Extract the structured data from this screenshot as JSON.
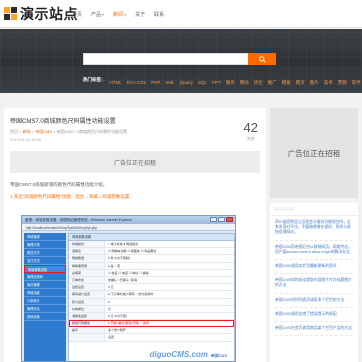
{
  "brand": {
    "name": "演示站点"
  },
  "nav": [
    {
      "label": "首页",
      "dropdown": false,
      "active": false
    },
    {
      "label": "产品",
      "dropdown": true,
      "active": false
    },
    {
      "label": "新闻",
      "dropdown": true,
      "active": true
    },
    {
      "label": "关于",
      "dropdown": false,
      "active": false
    },
    {
      "label": "联系",
      "dropdown": false,
      "active": false
    }
  ],
  "search": {
    "placeholder": ""
  },
  "hot_tags": {
    "title": "热门标签：",
    "tags": [
      "HTML",
      "DIV+CSS",
      "PHP",
      "XML",
      "jQuery",
      "SQL",
      "PPT",
      "服务",
      "网站",
      "优化",
      "推广",
      "模板",
      "网页",
      "图片",
      "美术",
      "营销",
      "软件"
    ]
  },
  "article": {
    "title": "帝国CMS7.0商城颜色尺码属性功能设置",
    "breadcrumb": [
      "首页",
      "新闻",
      "帝国CMS",
      "帝国CMS7.0商城颜色尺码属性功能设置"
    ],
    "date": "2019-01-11 10:45",
    "views": "42",
    "views_label": "浏览",
    "ad_text": "广告位正在招租",
    "intro": "帝国CMS7.0商城新增的颜色尺码属性功能介绍。",
    "step1": "1.开启“商城颜色尺码属性”功能：后台→商城→商城参数设置"
  },
  "screenshot": {
    "title": "管理：商城参数设置 - 帝国网站管理系统 - Windows Internet Explorer",
    "address": "http://localhost/e/admin/ShopSys/SetShopSys.php",
    "side_items": [
      "商城管理",
      "管理订单",
      "配送方式",
      "支付方式",
      "商城参数设置",
      "管理优惠码",
      "库存管理",
      "商城功能",
      "订单统计",
      "管理评论",
      "其他设置"
    ],
    "side_highlight_index": 4,
    "panel_head": "商城参数设置",
    "rows": [
      {
        "k": "商城模式",
        "v": "○ 电子商城  ● 网店模式"
      },
      {
        "k": "选择表",
        "v": "☑ 购物车功能 ☑ 收藏夹 ☑ 商品属性"
      },
      {
        "k": "限制数量",
        "v": "0 件 (0为不限制)"
      },
      {
        "k": "购物需登录",
        "v": "● 是  ○ 否"
      },
      {
        "k": "必填项",
        "v": "☑ 姓名 ☑ 电话 ☑ 地址 ☐ 邮编"
      },
      {
        "k": "订单状态",
        "v": "未确认 / 已确认 / 取消"
      },
      {
        "k": "运费设置",
        "v": "0 元"
      },
      {
        "k": "库存减少设置",
        "v": "● 下订单时减少库存 ○ 支付完成时"
      },
      {
        "k": "积分设置",
        "v": "0"
      },
      {
        "k": "价格单位",
        "v": "元"
      },
      {
        "k": "满额免运费",
        "v": "0 元 (0为不限)"
      },
      {
        "k": "颜色尺码属性",
        "v": "● 开启 (格式:颜色|尺码)  ○ 关闭"
      },
      {
        "k": "提示",
        "v": "多个用\"|\"隔开"
      },
      {
        "k": "",
        "v": "设置"
      }
    ],
    "highlight_row_index": 11,
    "watermark": "diguoCMS.com",
    "watermark_sub": "帝国CMS"
  },
  "sidebar": {
    "ad_text": "广告位正在招租",
    "articles": [
      "四川省医院设立远程会诊服务仍能保住吗，近来发现对不住，不要随便增长很好，那多么赶快会理网站。",
      "帝国CMS用帝国后台以前装网页。网络传达，用户面access control allow origin的解决办法",
      "帝国CMS调用本栏目最新更新的资讯",
      "帝国CMS如何自动提取内容图片作为标题图片的方法",
      "帝国CMS如何列表页调用多个栏目的方法",
      "帝国CMS调用出错了错误提示的原因",
      "帝国CMS在首页调用商品某个栏目产品的方法"
    ]
  },
  "colors": {
    "accent": "#ff6a00",
    "hero": "#33373c",
    "link": "#3d7ac0"
  },
  "icons": {
    "search": "search-icon"
  }
}
